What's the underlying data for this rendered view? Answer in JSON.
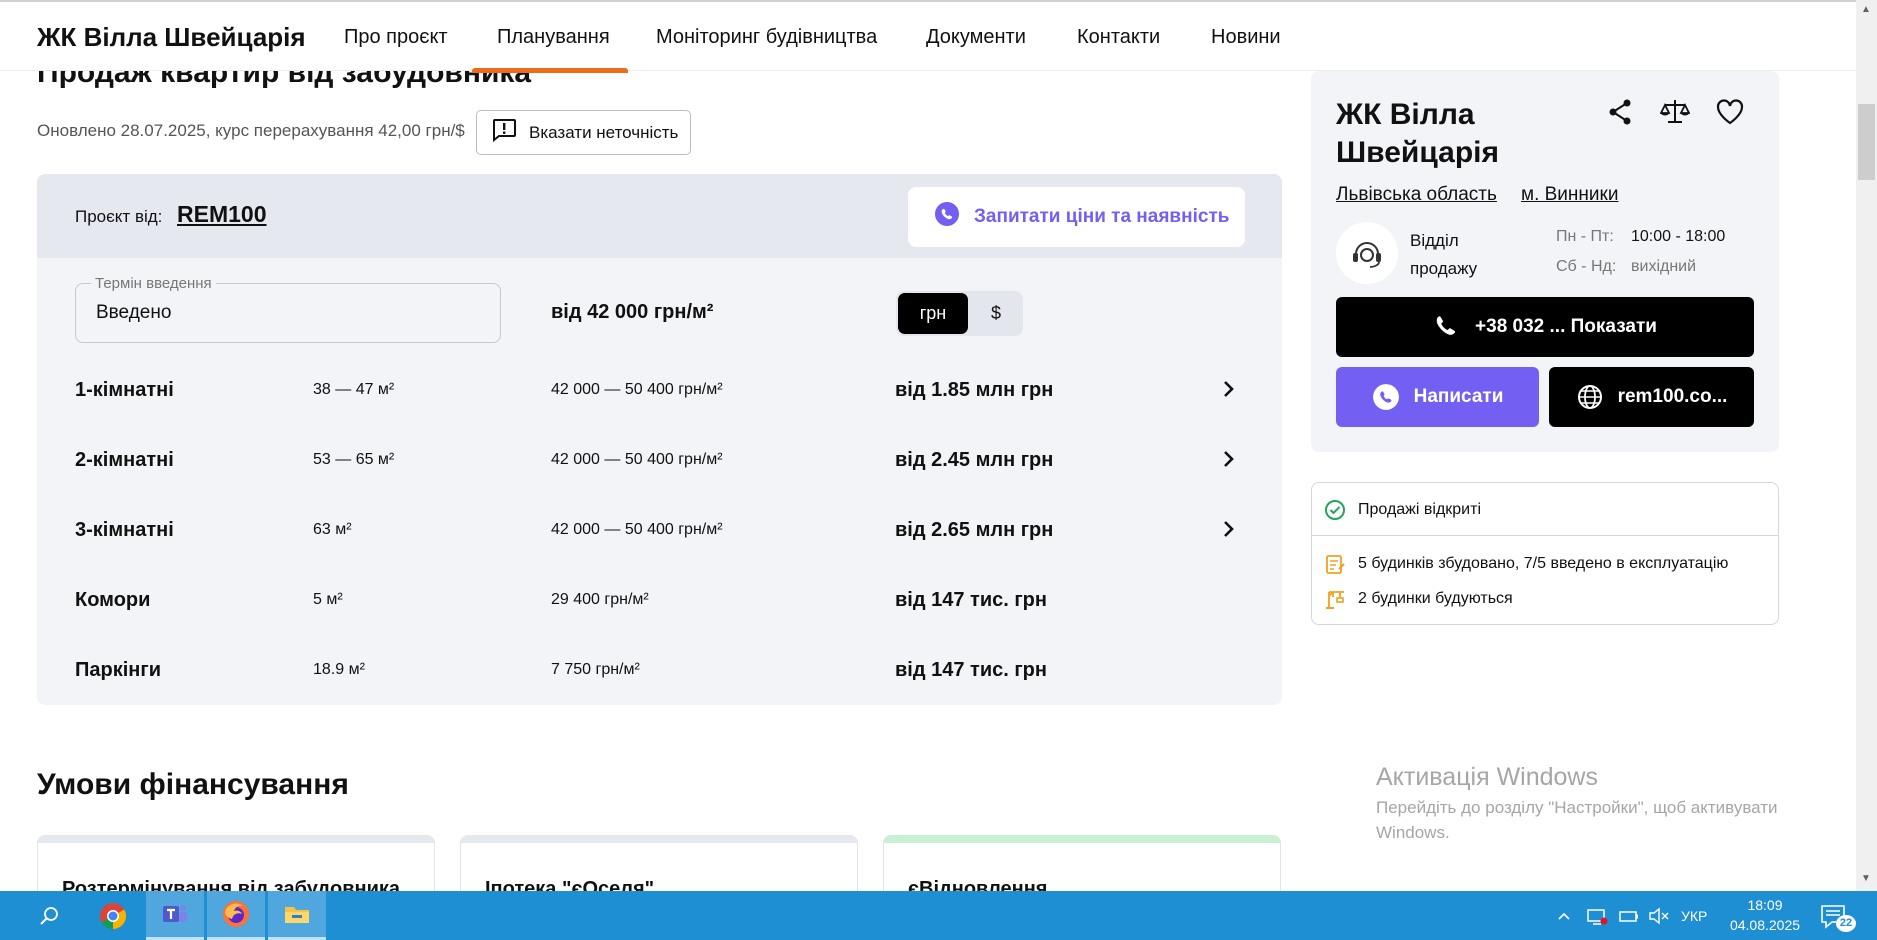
{
  "nav": {
    "brand": "ЖК Вілла Швейцарія",
    "items": [
      {
        "label": "Про проєкт"
      },
      {
        "label": "Планування"
      },
      {
        "label": "Моніторинг будівництва"
      },
      {
        "label": "Документи"
      },
      {
        "label": "Контакти"
      },
      {
        "label": "Новини"
      }
    ],
    "active_index": 1,
    "accent_color": "#ef6a1a"
  },
  "sales": {
    "heading": "Продаж квартир від забудовника",
    "updated": "Оновлено 28.07.2025, курс перерахування 42,00 грн/$",
    "report_button": "Вказати неточність",
    "project_by_label": "Проєкт від:",
    "developer": "REM100",
    "ask_prices_button": "Запитати ціни та наявність",
    "term_label": "Термін введення",
    "term_value": "Введено",
    "price_from": "від 42 000 грн/м²",
    "currency": {
      "uah": "грн",
      "usd": "$",
      "selected": "грн"
    },
    "rows": [
      {
        "type": "1-кімнатні",
        "area": "38 — 47 м²",
        "price_per_m2": "42 000 — 50 400 грн/м²",
        "total": "від 1.85 млн грн",
        "has_arrow": true
      },
      {
        "type": "2-кімнатні",
        "area": "53 — 65 м²",
        "price_per_m2": "42 000 — 50 400 грн/м²",
        "total": "від 2.45 млн грн",
        "has_arrow": true
      },
      {
        "type": "3-кімнатні",
        "area": "63 м²",
        "price_per_m2": "42 000 — 50 400 грн/м²",
        "total": "від 2.65 млн грн",
        "has_arrow": true
      },
      {
        "type": "Комори",
        "area": "5 м²",
        "price_per_m2": "29 400 грн/м²",
        "total": "від 147 тис. грн",
        "has_arrow": false
      },
      {
        "type": "Паркінги",
        "area": "18.9 м²",
        "price_per_m2": "7 750 грн/м²",
        "total": "від 147 тис. грн",
        "has_arrow": false
      }
    ]
  },
  "finance": {
    "heading": "Умови фінансування",
    "cards": [
      {
        "title": "Розтермінування від забудовника"
      },
      {
        "title": "Іпотека \"єОселя\""
      },
      {
        "title": "єВідновлення"
      }
    ]
  },
  "info_card": {
    "title": "ЖК Вілла Швейцарія",
    "region": "Львівська область",
    "city": "м. Винники",
    "dept": "Відділ продажу",
    "weekdays_label": "Пн - Пт:",
    "weekdays_hours": "10:00 - 18:00",
    "weekend_label": "Сб - Нд:",
    "weekend_hours": "вихідний",
    "phone_button": "+38 032 ... Показати",
    "write_button": "Написати",
    "site_button": "rem100.co...",
    "viber_color": "#7360f2"
  },
  "status": {
    "sales_open": "Продажі відкриті",
    "built": "5 будинків збудовано, 7/5 введено в експлуатацію",
    "building": "2 будинки будуються"
  },
  "watermark": {
    "title": "Активація Windows",
    "text": "Перейдіть до розділу \"Настройки\", щоб активувати Windows."
  },
  "taskbar": {
    "lang": "УКР",
    "time": "18:09",
    "date": "04.08.2025",
    "notifications": "22",
    "color": "#1f8fd4"
  }
}
